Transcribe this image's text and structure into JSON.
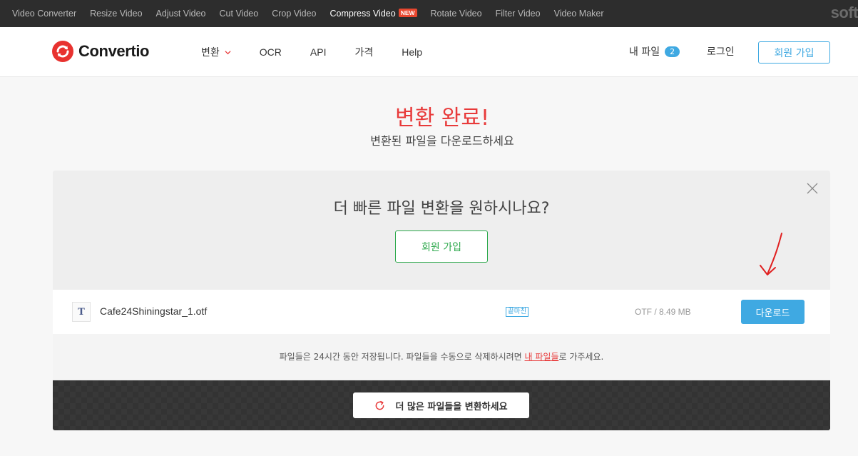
{
  "topbar": {
    "links": [
      "Video Converter",
      "Resize Video",
      "Adjust Video",
      "Cut Video",
      "Crop Video",
      "Compress Video",
      "Rotate Video",
      "Filter Video",
      "Video Maker"
    ],
    "new_badge": "NEW",
    "brand_partial": "soft"
  },
  "header": {
    "logo_text": "Convertio",
    "nav": [
      "변환",
      "OCR",
      "API",
      "가격",
      "Help"
    ],
    "my_files_label": "내 파일",
    "my_files_count": "2",
    "login_label": "로그인",
    "signup_label": "회원 가입"
  },
  "hero": {
    "title": "변환 완료!",
    "subtitle": "변환된 파일을 다운로드하세요"
  },
  "promo": {
    "text": "더 빠른 파일 변환을 원하시나요?",
    "button_label": "회원 가입"
  },
  "file": {
    "icon_glyph": "T",
    "name": "Cafe24Shiningstar_1.otf",
    "status": "끝마친",
    "meta": "OTF / 8.49 MB",
    "download_label": "다운로드"
  },
  "notice": {
    "before": "파일들은 24시간 동안 저장됩니다. 파일들을 수동으로 삭제하시려면 ",
    "link": "내 파일들",
    "after": "로 가주세요."
  },
  "convert_more": {
    "label": "더 많은 파일들을 변환하세요"
  },
  "colors": {
    "accent_blue": "#3fa9e2",
    "brand_red": "#e83a3a",
    "promo_green": "#2ca84b",
    "topbar_bg": "#2d2d2d"
  }
}
